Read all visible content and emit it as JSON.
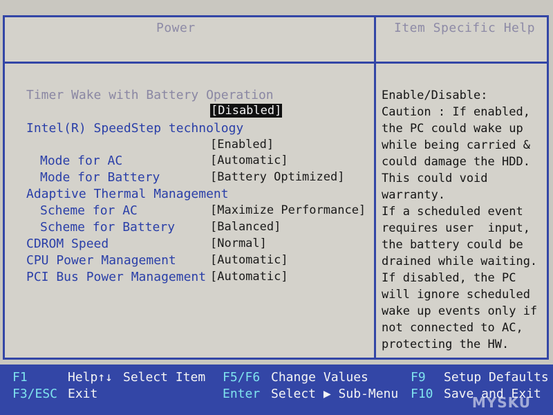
{
  "header": {
    "left_title": "Power",
    "right_title": "Item Specific Help"
  },
  "items": [
    {
      "label": "Timer Wake with Battery Operation",
      "value": "[Disabled]",
      "selected": true
    },
    {
      "label": "Intel(R) SpeedStep technology",
      "value": "[Enabled]"
    },
    {
      "label": "Mode for AC",
      "value": "[Automatic]"
    },
    {
      "label": "Mode for Battery",
      "value": "[Battery Optimized]"
    },
    {
      "label": "Adaptive Thermal Management"
    },
    {
      "label": "Scheme for AC",
      "value": "[Maximize Performance]"
    },
    {
      "label": "Scheme for Battery",
      "value": "[Balanced]"
    },
    {
      "label": "CDROM Speed",
      "value": "[Normal]"
    },
    {
      "label": "CPU Power Management",
      "value": "[Automatic]"
    },
    {
      "label": "PCI Bus Power Management",
      "value": "[Automatic]"
    }
  ],
  "help": [
    "Enable/Disable:",
    "Caution : If enabled,",
    "the PC could wake up",
    "while being carried &",
    "could damage the HDD.",
    "This could void",
    "warranty.",
    "If a scheduled event",
    "requires user  input,",
    "the battery could be",
    "drained while waiting.",
    "If disabled, the PC",
    "will ignore scheduled",
    "wake up events only if",
    "not connected to AC,",
    "protecting the HW."
  ],
  "footer": {
    "f1_key": "F1",
    "f1_desc": "Help↑↓",
    "select_item": "Select Item",
    "f5f6_key": "F5/F6",
    "change_values": "Change Values",
    "f9_key": "F9",
    "setup_defaults": "Setup Defaults",
    "esc_key": "F3/ESC",
    "exit_desc": "Exit",
    "enter_key": "Enter",
    "select_submenu": "Select ▶ Sub-Menu",
    "f10_key": "F10",
    "save_exit": "Save and Exit"
  },
  "watermark": "MYSKU",
  "colors": {
    "frame": "#3346a6",
    "item_text": "#2a3fa8",
    "key_text": "#7fe3ee",
    "background": "#d4d2cb"
  }
}
